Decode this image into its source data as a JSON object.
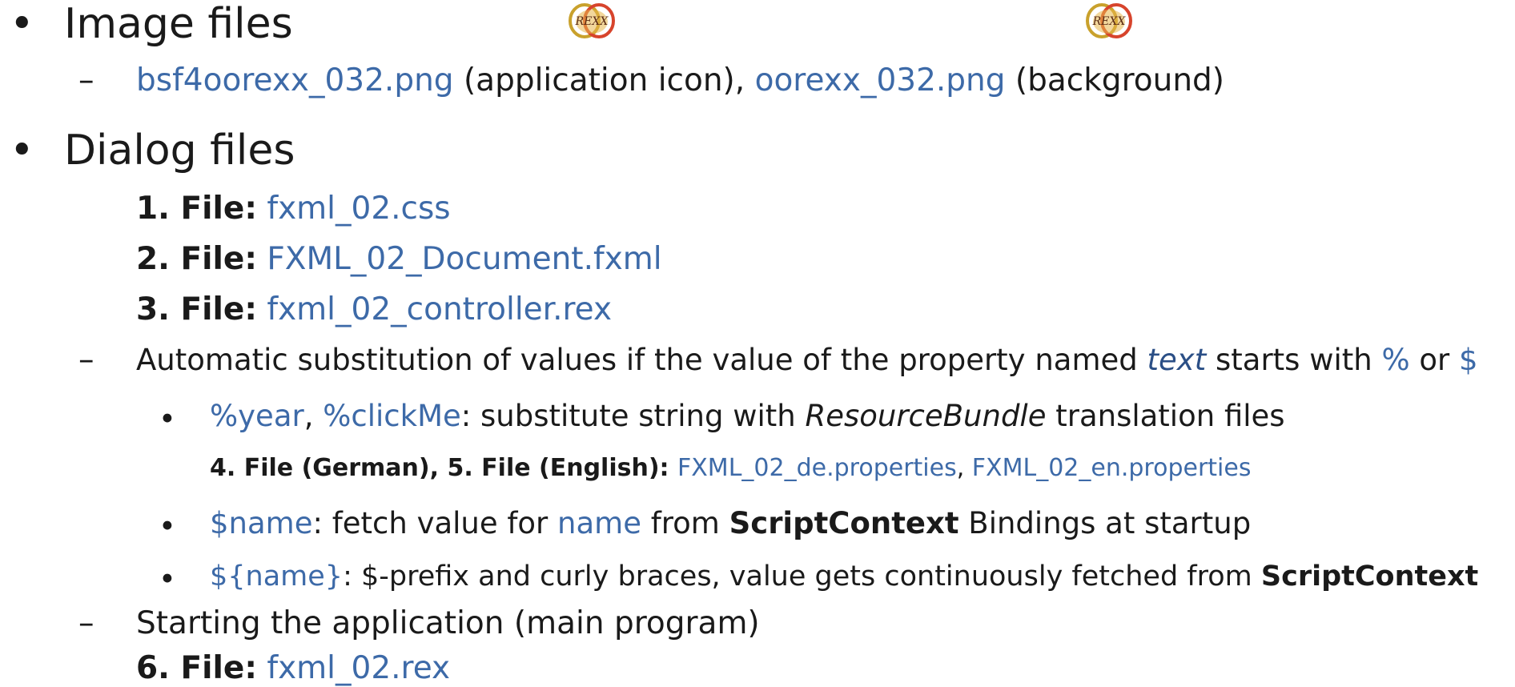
{
  "image_section": {
    "title": "Image files",
    "link1": "bsf4oorexx_032.png",
    "desc1": " (application icon), ",
    "link2": "oorexx_032.png",
    "desc2": " (background)"
  },
  "logo_label": "REXX",
  "dialog_section": {
    "title": "Dialog files",
    "files": [
      {
        "label": "1. File:",
        "name": "fxml_02.css"
      },
      {
        "label": "2. File:",
        "name": "FXML_02_Document.fxml"
      },
      {
        "label": "3. File:",
        "name": "fxml_02_controller.rex"
      }
    ],
    "substitution": {
      "text_before": "Automatic substitution of values if the value of the property named ",
      "text_italic": "text",
      "text_after": " starts with ",
      "sym1": "%",
      "or": " or ",
      "sym2": "$"
    },
    "bullet_year": {
      "link1": "%year",
      "comma": ", ",
      "link2": "%clickMe",
      "text1": ": substitute string with ",
      "italic": "ResourceBundle",
      "text2": " translation files"
    },
    "translation_files": {
      "label": "4. File (German), 5. File (English): ",
      "link1": "FXML_02_de.properties",
      "comma": ", ",
      "link2": "FXML_02_en.properties"
    },
    "bullet_name": {
      "link1": "$name",
      "text1": ": fetch value for ",
      "link2": "name",
      "text2": " from ",
      "bold": "ScriptContext",
      "text3": " Bindings at startup"
    },
    "bullet_curly": {
      "link1": "${name}",
      "text1": ": $-prefix and curly braces, value gets continuously fetched from ",
      "bold": "ScriptContext"
    },
    "starting": "Starting the application (main program)",
    "main_file": {
      "label": "6. File:",
      "name": "fxml_02.rex"
    }
  },
  "bullets": {
    "l1": "•",
    "l2": "–",
    "l3": "•"
  }
}
